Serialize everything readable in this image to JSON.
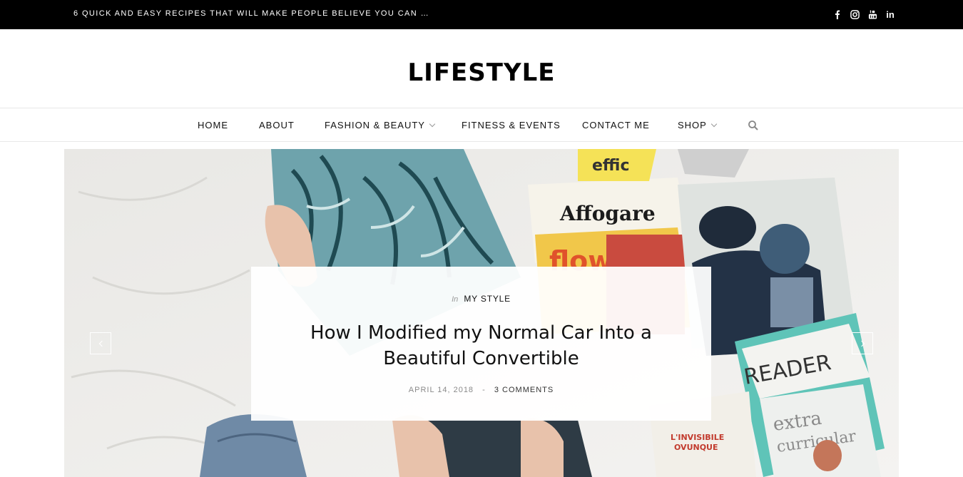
{
  "topbar": {
    "ticker": "6 QUICK AND EASY RECIPES THAT WILL MAKE PEOPLE BELIEVE YOU CAN …",
    "social": [
      "facebook-icon",
      "instagram-icon",
      "youtube-icon",
      "linkedin-icon"
    ],
    "linkedin_text": "in"
  },
  "site": {
    "logo": "LIFESTYLE"
  },
  "nav": {
    "items": [
      {
        "label": "HOME",
        "has_dropdown": false
      },
      {
        "label": "ABOUT",
        "has_dropdown": false
      },
      {
        "label": "FASHION & BEAUTY",
        "has_dropdown": true
      },
      {
        "label": "FITNESS & EVENTS",
        "has_dropdown": false
      },
      {
        "label": "CONTACT ME",
        "has_dropdown": false
      },
      {
        "label": "SHOP",
        "has_dropdown": true
      }
    ],
    "search_icon": "search-icon"
  },
  "slider": {
    "category_prefix": "In",
    "category": "MY STYLE",
    "title": "How I Modified my Normal Car Into a Beautiful Convertible",
    "date": "APRIL 14, 2018",
    "separator": "-",
    "comments": "3 COMMENTS",
    "prev_icon": "chevron-left-icon",
    "next_icon": "chevron-right-icon",
    "image_texts": {
      "mag1": "Affogare",
      "mag2": "flow",
      "mag3": "READER",
      "mag4": "extra curricular",
      "mag5": "L'INVISIBILE OVUNQUE"
    }
  },
  "colors": {
    "topbar_bg": "#000000",
    "text": "#111111",
    "muted": "#8a8a8a",
    "teal": "#5fc4b8"
  }
}
